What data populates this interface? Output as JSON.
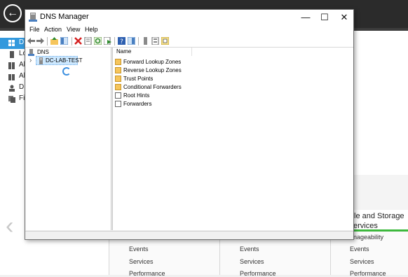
{
  "background": {
    "back_glyph": "←",
    "sidebar_items": [
      "D",
      "Lo",
      "Al",
      "Al",
      "D",
      "Fi"
    ],
    "file_storage_title": "le and Storage",
    "file_storage_sub": "ervices",
    "manageability": "anageability",
    "tile_items": {
      "events": "Events",
      "services": "Services",
      "performance": "Performance"
    },
    "nav_arrow": "‹"
  },
  "window": {
    "title": "DNS Manager",
    "controls": {
      "minimize": "—",
      "maximize": "☐",
      "close": "✕"
    },
    "menu": [
      "File",
      "Action",
      "View",
      "Help"
    ],
    "tree": {
      "root": "DNS",
      "server": "DC-LAB-TEST",
      "expander": "›"
    },
    "list": {
      "column_name": "Name",
      "items": [
        {
          "label": "Forward Lookup Zones",
          "icon": "folder-icon"
        },
        {
          "label": "Reverse Lookup Zones",
          "icon": "folder-icon"
        },
        {
          "label": "Trust Points",
          "icon": "folder-icon"
        },
        {
          "label": "Conditional Forwarders",
          "icon": "folder-icon"
        },
        {
          "label": "Root Hints",
          "icon": "document-icon"
        },
        {
          "label": "Forwarders",
          "icon": "document-icon"
        }
      ]
    }
  },
  "colors": {
    "selection": "#cce8ff",
    "active_nav": "#3399dd",
    "green_accent": "#3db83d"
  }
}
